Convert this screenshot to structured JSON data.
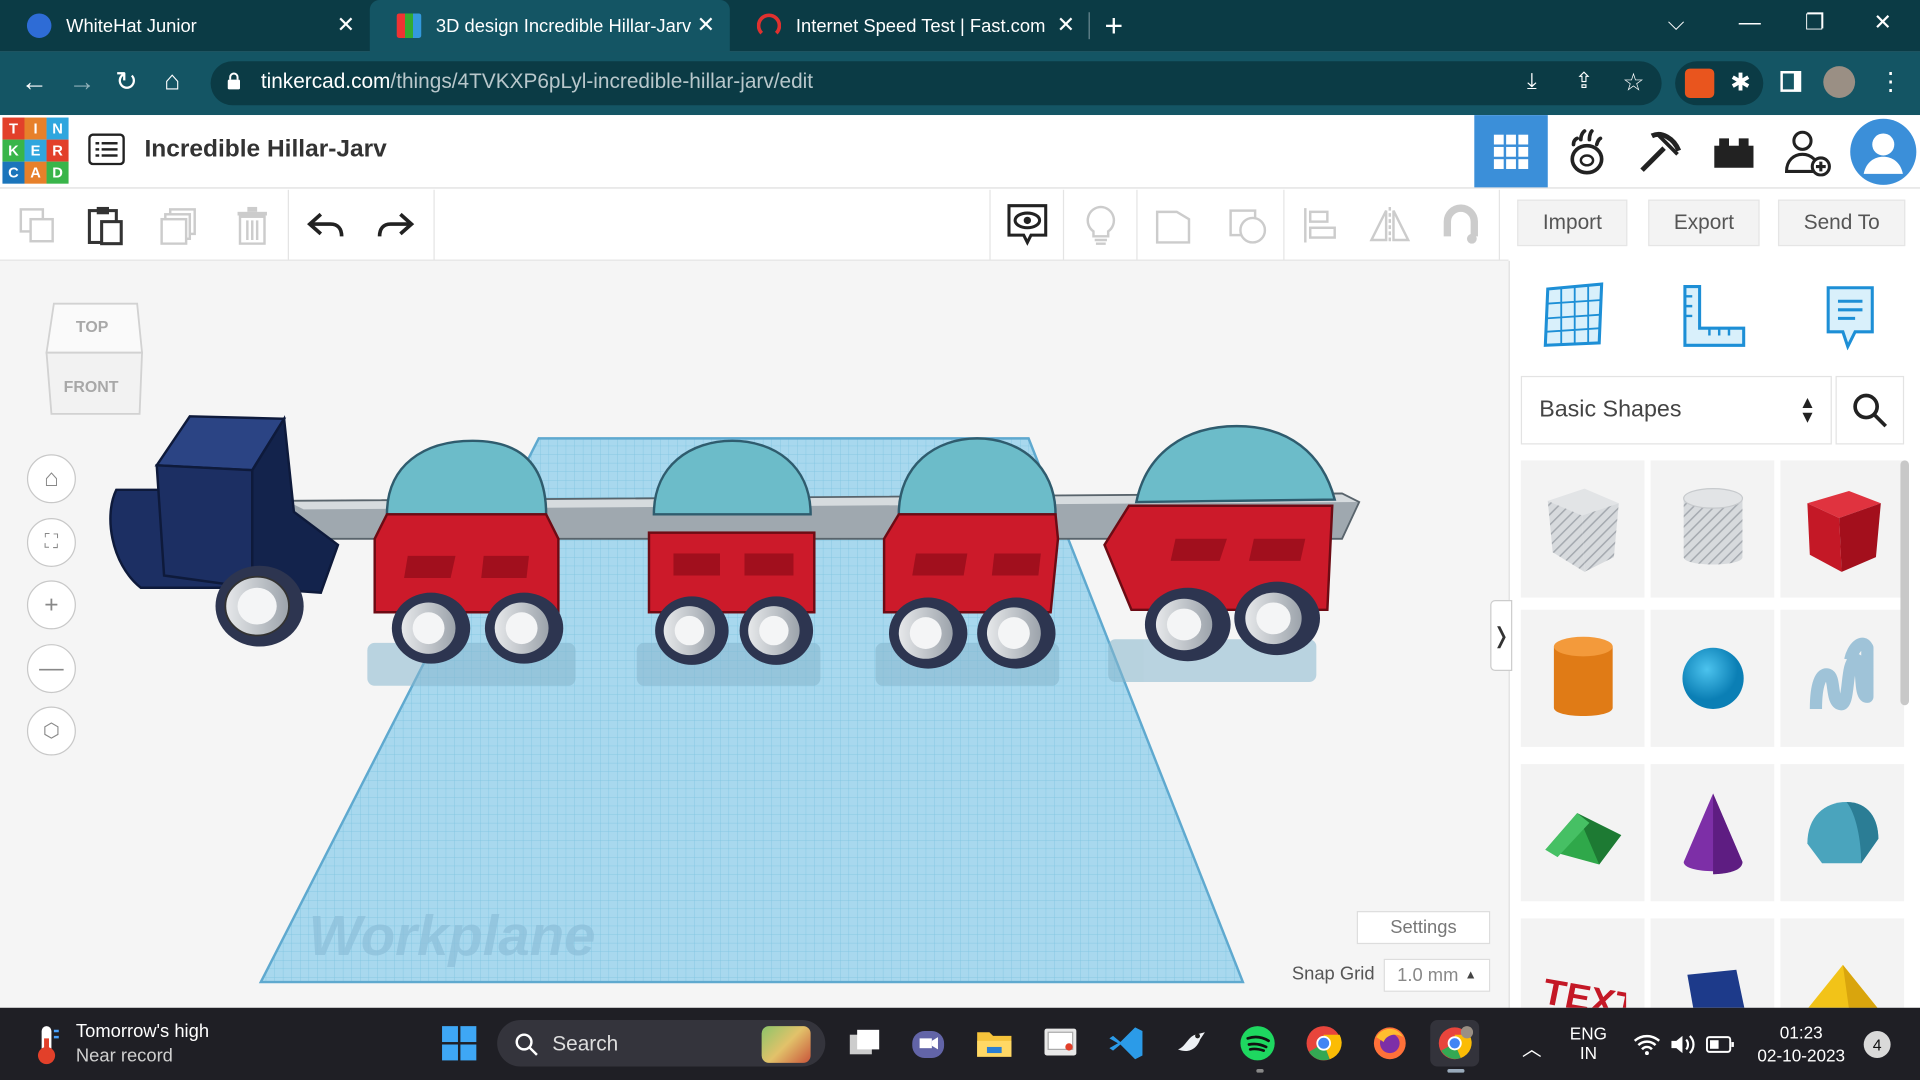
{
  "browser": {
    "tabs": [
      {
        "label": "WhiteHat Junior",
        "active": false
      },
      {
        "label": "3D design Incredible Hillar-Jarv | ",
        "active": true
      },
      {
        "label": "Internet Speed Test | Fast.com",
        "active": false
      }
    ],
    "url_host": "tinkercad.com",
    "url_path": "/things/4TVKXP6pLyl-incredible-hillar-jarv/edit"
  },
  "app": {
    "logo_letters": [
      "T",
      "I",
      "N",
      "K",
      "E",
      "R",
      "C",
      "A",
      "D"
    ],
    "design_title": "Incredible Hillar-Jarv"
  },
  "toolbar": {
    "import_label": "Import",
    "export_label": "Export",
    "send_to_label": "Send To"
  },
  "viewcube": {
    "top_label": "TOP",
    "front_label": "FRONT"
  },
  "workplane": {
    "watermark": "Workplane",
    "settings_label": "Settings",
    "snap_grid_label": "Snap Grid",
    "snap_grid_value": "1.0 mm"
  },
  "panel": {
    "shape_library": "Basic Shapes",
    "shapes": [
      "box-hole",
      "cylinder-hole",
      "box",
      "cylinder",
      "sphere",
      "scribble",
      "roof",
      "cone",
      "round-roof",
      "text",
      "wedge",
      "pyramid"
    ]
  },
  "taskbar": {
    "weather_line1": "Tomorrow's high",
    "weather_line2": "Near record",
    "search_label": "Search",
    "lang_line1": "ENG",
    "lang_line2": "IN",
    "time": "01:23",
    "date": "02-10-2023",
    "notification_count": "4"
  },
  "colors": {
    "chrome_dark": "#0b3b45",
    "chrome_light": "#145564",
    "tinkercad_blue": "#3b8fd9",
    "workplane": "#9fd3ea",
    "engine": "#1c2f63",
    "car_body": "#cc1a2a",
    "car_roof": "#6cbcc9"
  }
}
